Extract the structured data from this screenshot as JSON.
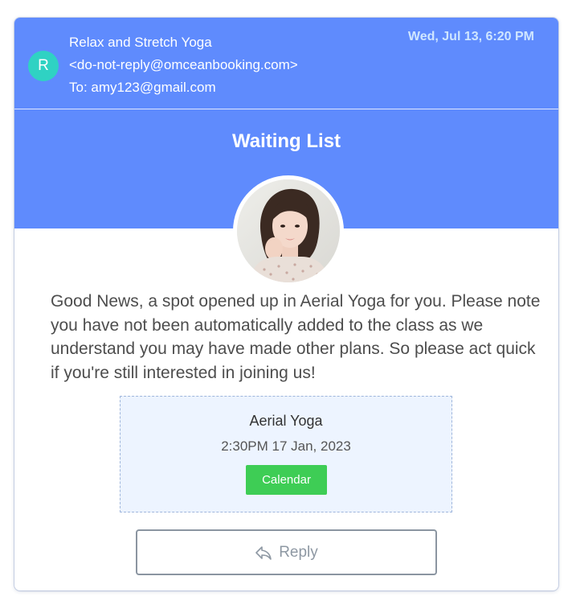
{
  "email": {
    "sender_initial": "R",
    "sender_name": "Relax and Stretch Yoga",
    "sender_email": "<do-not-reply@omceanbooking.com>",
    "to_line": "To: amy123@gmail.com",
    "date": "Wed, Jul 13, 6:20 PM"
  },
  "banner": {
    "title": "Waiting List"
  },
  "body": {
    "message": "Good News, a spot opened up in Aerial Yoga for you. Please note you have not been automatically added to the class as we understand you may have made other plans. So please act quick if you're still interested in joining us!"
  },
  "event": {
    "name": "Aerial Yoga",
    "datetime": "2:30PM 17 Jan, 2023",
    "calendar_label": "Calendar"
  },
  "actions": {
    "reply_label": "Reply",
    "reply_icon": "reply-arrow-icon"
  },
  "colors": {
    "header_bg": "#5f8bfd",
    "avatar_bg": "#2fd2c3",
    "calendar_btn": "#3ecd55",
    "event_box_bg": "#edf4ff"
  }
}
